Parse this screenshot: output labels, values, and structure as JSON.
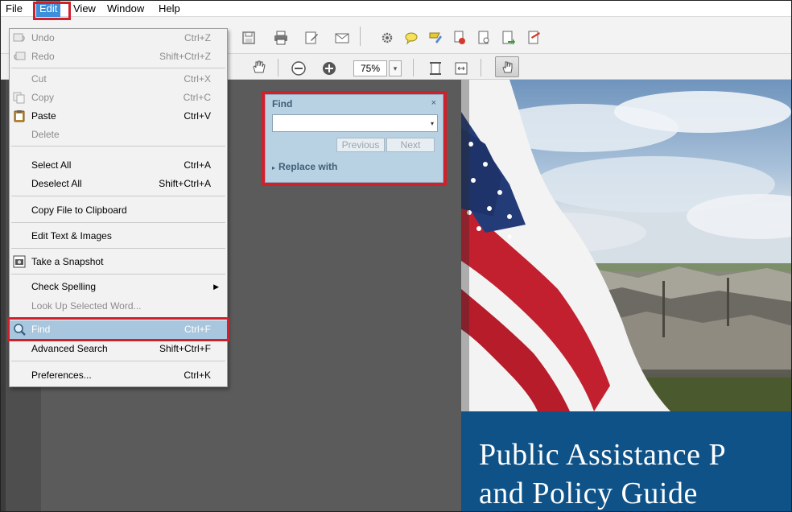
{
  "menubar": {
    "items": [
      {
        "label": "File"
      },
      {
        "label": "Edit"
      },
      {
        "label": "View"
      },
      {
        "label": "Window"
      },
      {
        "label": "Help"
      }
    ]
  },
  "edit_menu": {
    "items": [
      {
        "label": "Undo",
        "shortcut": "Ctrl+Z",
        "disabled": true,
        "icon": "undo-icon"
      },
      {
        "label": "Redo",
        "shortcut": "Shift+Ctrl+Z",
        "disabled": true,
        "icon": "redo-icon"
      },
      {
        "label": "Cut",
        "shortcut": "Ctrl+X",
        "disabled": true
      },
      {
        "label": "Copy",
        "shortcut": "Ctrl+C",
        "disabled": true,
        "icon": "copy-icon"
      },
      {
        "label": "Paste",
        "shortcut": "Ctrl+V",
        "disabled": false,
        "icon": "clipboard-icon"
      },
      {
        "label": "Delete",
        "shortcut": "",
        "disabled": true
      },
      {
        "label": "Select All",
        "shortcut": "Ctrl+A",
        "disabled": false
      },
      {
        "label": "Deselect All",
        "shortcut": "Shift+Ctrl+A",
        "disabled": false
      },
      {
        "label": "Copy File to Clipboard",
        "shortcut": "",
        "disabled": false
      },
      {
        "label": "Edit Text & Images",
        "shortcut": "",
        "disabled": false
      },
      {
        "label": "Take a Snapshot",
        "shortcut": "",
        "disabled": false,
        "icon": "camera-icon"
      },
      {
        "label": "Check Spelling",
        "shortcut": "",
        "disabled": false,
        "submenu": true
      },
      {
        "label": "Look Up Selected Word...",
        "shortcut": "",
        "disabled": true
      },
      {
        "label": "Find",
        "shortcut": "Ctrl+F",
        "disabled": false,
        "selected": true,
        "icon": "magnifier-icon"
      },
      {
        "label": "Advanced Search",
        "shortcut": "Shift+Ctrl+F",
        "disabled": false
      },
      {
        "label": "Preferences...",
        "shortcut": "Ctrl+K",
        "disabled": false
      }
    ]
  },
  "toolbar": {
    "zoom_value": "75%",
    "zoom_arrow": "▾"
  },
  "find_panel": {
    "title": "Find",
    "close": "×",
    "search_value": "",
    "dropdown_glyph": "▾",
    "previous_label": "Previous",
    "next_label": "Next",
    "replace_label": "Replace with",
    "replace_glyph": "▸"
  },
  "document": {
    "title_line1": "Public Assistance P",
    "title_line2": "and Policy Guide"
  },
  "colors": {
    "menu_highlight": "#3b8fdb",
    "selection": "#a8c6de",
    "callout_red": "#d0202a",
    "find_panel_bg": "#b8d2e3",
    "doc_banner": "#0e5288"
  }
}
